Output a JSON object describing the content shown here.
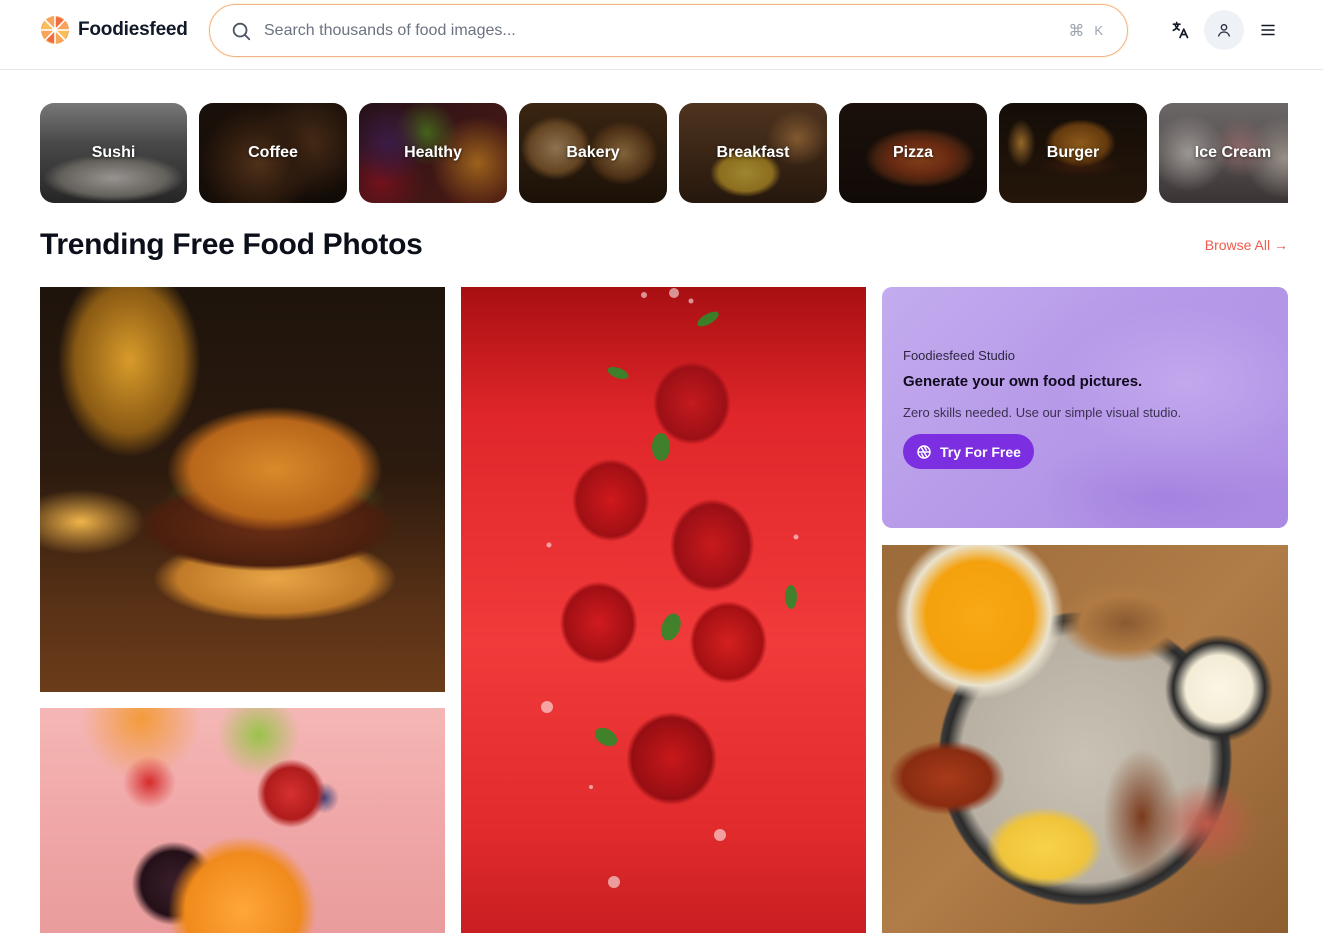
{
  "brand": {
    "name": "Foodiesfeed"
  },
  "search": {
    "placeholder": "Search thousands of food images...",
    "shortcut_symbol": "⌘",
    "shortcut_key": "K"
  },
  "header_icons": [
    "translate-icon",
    "user-icon",
    "menu-icon"
  ],
  "categories": [
    {
      "label": "Sushi",
      "colors": [
        "#cfcfcf",
        "#5a5a5a"
      ]
    },
    {
      "label": "Coffee",
      "colors": [
        "#6b4526",
        "#1c120b"
      ]
    },
    {
      "label": "Healthy",
      "colors": [
        "#7a1c2a",
        "#e0892a"
      ]
    },
    {
      "label": "Bakery",
      "colors": [
        "#c8995a",
        "#4a3018"
      ]
    },
    {
      "label": "Breakfast",
      "colors": [
        "#9a6a3a",
        "#e7c24a"
      ]
    },
    {
      "label": "Pizza",
      "colors": [
        "#3a2418",
        "#c24a2a"
      ]
    },
    {
      "label": "Burger",
      "colors": [
        "#2c1a0e",
        "#d98a2a"
      ]
    },
    {
      "label": "Ice Cream",
      "colors": [
        "#e8e0dc",
        "#c76a6a"
      ]
    }
  ],
  "section": {
    "title": "Trending Free Food Photos",
    "browse_all": "Browse All →"
  },
  "promo": {
    "eyebrow": "Foodiesfeed Studio",
    "title": "Generate your own food pictures.",
    "description": "Zero skills needed. Use our simple visual studio.",
    "button_label": "Try For Free"
  },
  "colors": {
    "accent": "#ef5b4c",
    "promo_button": "#7c2fe0",
    "search_border": "#f3b48c"
  }
}
